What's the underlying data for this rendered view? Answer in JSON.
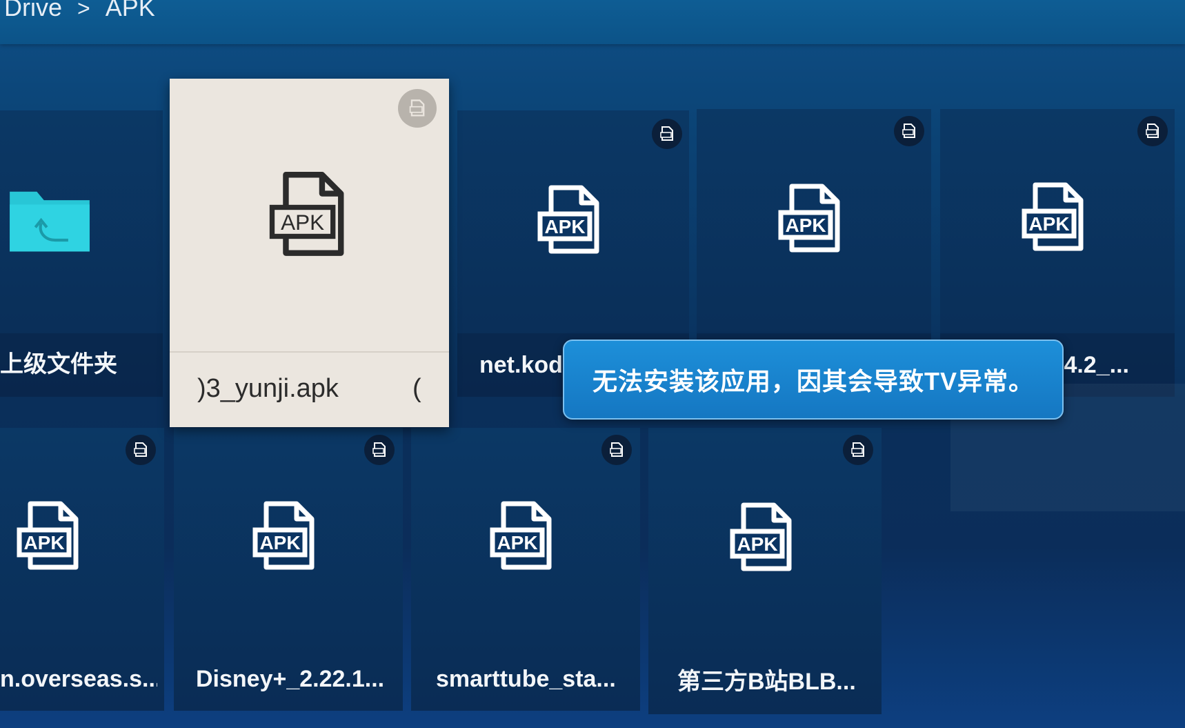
{
  "breadcrumb": {
    "root": "Drive",
    "separator": ">",
    "current": "APK"
  },
  "focused_item": {
    "label": ")3_yunji.apk",
    "trail": "(",
    "icon": "apk-file-icon",
    "badge_icon": "apk-badge-icon"
  },
  "row1": [
    {
      "label": "上级文件夹",
      "icon": "folder-up-icon"
    },
    {
      "label": "net.kodi",
      "icon": "apk-file-icon"
    },
    {
      "label": "",
      "icon": "apk-file-icon"
    },
    {
      "label": ".4.2_...",
      "icon": "apk-file-icon"
    }
  ],
  "row2": [
    {
      "label": "n.overseas.s...",
      "icon": "apk-file-icon"
    },
    {
      "label": "Disney+_2.22.1...",
      "icon": "apk-file-icon"
    },
    {
      "label": "smarttube_sta...",
      "icon": "apk-file-icon"
    },
    {
      "label": "第三方B站BLB...",
      "icon": "apk-file-icon"
    }
  ],
  "icon_text": "APK",
  "toast": {
    "message": "无法安装该应用，因其会导致TV异常。"
  },
  "colors": {
    "accent": "#1a85d0",
    "folder": "#28c6d6",
    "focused_bg": "#ebe6df"
  }
}
